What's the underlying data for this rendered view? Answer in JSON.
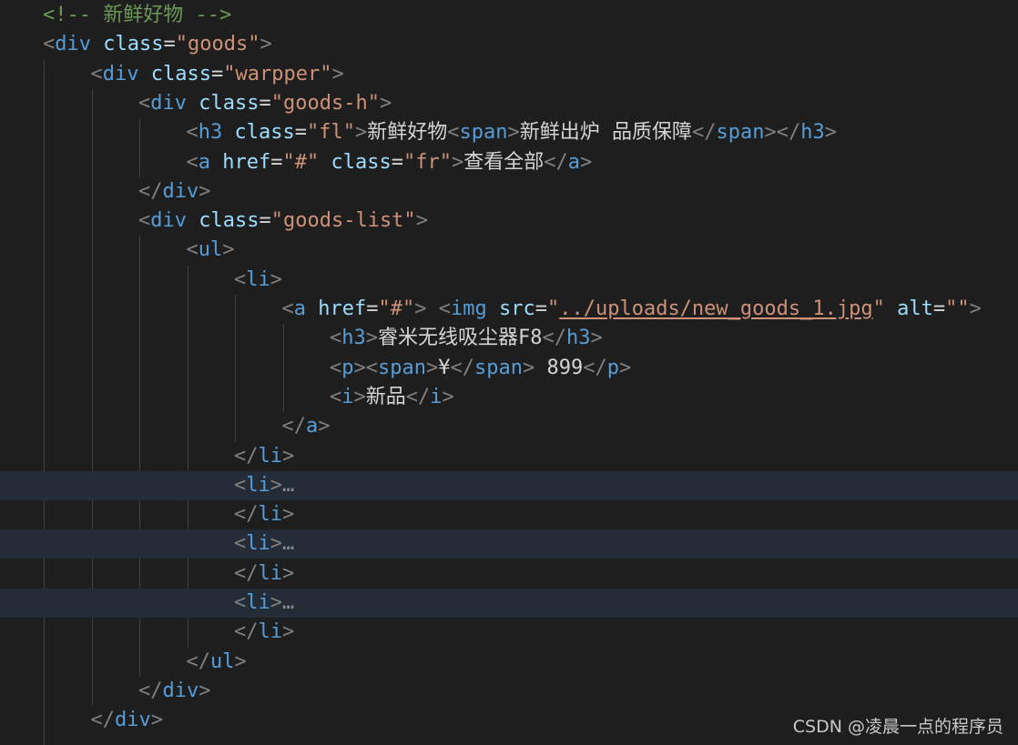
{
  "editor": {
    "language": "html",
    "colors": {
      "background": "#1e1e1e",
      "folded_line_background": "#232c37",
      "comment": "#6a9955",
      "tag": "#569cd6",
      "attribute": "#9cdcfe",
      "string": "#ce9178",
      "text": "#d4d4d4",
      "punctuation": "#808080"
    },
    "lines": [
      {
        "indent": 1,
        "tokens": [
          {
            "t": "comment",
            "v": "<!-- 新鲜好物 -->"
          }
        ]
      },
      {
        "indent": 1,
        "tokens": [
          {
            "t": "punc",
            "v": "<"
          },
          {
            "t": "tag",
            "v": "div"
          },
          {
            "t": "text",
            "v": " "
          },
          {
            "t": "attr",
            "v": "class"
          },
          {
            "t": "eq",
            "v": "="
          },
          {
            "t": "str",
            "v": "\"goods\""
          },
          {
            "t": "punc",
            "v": ">"
          }
        ]
      },
      {
        "indent": 2,
        "tokens": [
          {
            "t": "punc",
            "v": "<"
          },
          {
            "t": "tag",
            "v": "div"
          },
          {
            "t": "text",
            "v": " "
          },
          {
            "t": "attr",
            "v": "class"
          },
          {
            "t": "eq",
            "v": "="
          },
          {
            "t": "str",
            "v": "\"warpper\""
          },
          {
            "t": "punc",
            "v": ">"
          }
        ]
      },
      {
        "indent": 3,
        "tokens": [
          {
            "t": "punc",
            "v": "<"
          },
          {
            "t": "tag",
            "v": "div"
          },
          {
            "t": "text",
            "v": " "
          },
          {
            "t": "attr",
            "v": "class"
          },
          {
            "t": "eq",
            "v": "="
          },
          {
            "t": "str",
            "v": "\"goods-h\""
          },
          {
            "t": "punc",
            "v": ">"
          }
        ]
      },
      {
        "indent": 4,
        "tokens": [
          {
            "t": "punc",
            "v": "<"
          },
          {
            "t": "tag",
            "v": "h3"
          },
          {
            "t": "text",
            "v": " "
          },
          {
            "t": "attr",
            "v": "class"
          },
          {
            "t": "eq",
            "v": "="
          },
          {
            "t": "str",
            "v": "\"fl\""
          },
          {
            "t": "punc",
            "v": ">"
          },
          {
            "t": "text",
            "v": "新鲜好物"
          },
          {
            "t": "punc",
            "v": "<"
          },
          {
            "t": "tag",
            "v": "span"
          },
          {
            "t": "punc",
            "v": ">"
          },
          {
            "t": "text",
            "v": "新鲜出炉 品质保障"
          },
          {
            "t": "punc",
            "v": "</"
          },
          {
            "t": "tag",
            "v": "span"
          },
          {
            "t": "punc",
            "v": "></"
          },
          {
            "t": "tag",
            "v": "h3"
          },
          {
            "t": "punc",
            "v": ">"
          }
        ]
      },
      {
        "indent": 4,
        "tokens": [
          {
            "t": "punc",
            "v": "<"
          },
          {
            "t": "tag",
            "v": "a"
          },
          {
            "t": "text",
            "v": " "
          },
          {
            "t": "attr",
            "v": "href"
          },
          {
            "t": "eq",
            "v": "="
          },
          {
            "t": "str",
            "v": "\"#\""
          },
          {
            "t": "text",
            "v": " "
          },
          {
            "t": "attr",
            "v": "class"
          },
          {
            "t": "eq",
            "v": "="
          },
          {
            "t": "str",
            "v": "\"fr\""
          },
          {
            "t": "punc",
            "v": ">"
          },
          {
            "t": "text",
            "v": "查看全部"
          },
          {
            "t": "punc",
            "v": "</"
          },
          {
            "t": "tag",
            "v": "a"
          },
          {
            "t": "punc",
            "v": ">"
          }
        ]
      },
      {
        "indent": 3,
        "tokens": [
          {
            "t": "punc",
            "v": "</"
          },
          {
            "t": "tag",
            "v": "div"
          },
          {
            "t": "punc",
            "v": ">"
          }
        ]
      },
      {
        "indent": 3,
        "tokens": [
          {
            "t": "punc",
            "v": "<"
          },
          {
            "t": "tag",
            "v": "div"
          },
          {
            "t": "text",
            "v": " "
          },
          {
            "t": "attr",
            "v": "class"
          },
          {
            "t": "eq",
            "v": "="
          },
          {
            "t": "str",
            "v": "\"goods-list\""
          },
          {
            "t": "punc",
            "v": ">"
          }
        ]
      },
      {
        "indent": 4,
        "tokens": [
          {
            "t": "punc",
            "v": "<"
          },
          {
            "t": "tag",
            "v": "ul"
          },
          {
            "t": "punc",
            "v": ">"
          }
        ]
      },
      {
        "indent": 5,
        "tokens": [
          {
            "t": "punc",
            "v": "<"
          },
          {
            "t": "tag",
            "v": "li"
          },
          {
            "t": "punc",
            "v": ">"
          }
        ]
      },
      {
        "indent": 6,
        "tokens": [
          {
            "t": "punc",
            "v": "<"
          },
          {
            "t": "tag",
            "v": "a"
          },
          {
            "t": "text",
            "v": " "
          },
          {
            "t": "attr",
            "v": "href"
          },
          {
            "t": "eq",
            "v": "="
          },
          {
            "t": "str",
            "v": "\"#\""
          },
          {
            "t": "punc",
            "v": ">"
          },
          {
            "t": "text",
            "v": " "
          },
          {
            "t": "punc",
            "v": "<"
          },
          {
            "t": "tag",
            "v": "img"
          },
          {
            "t": "text",
            "v": " "
          },
          {
            "t": "attr",
            "v": "src"
          },
          {
            "t": "eq",
            "v": "="
          },
          {
            "t": "str",
            "v": "\""
          },
          {
            "t": "str link",
            "v": "../uploads/new_goods_1.jpg"
          },
          {
            "t": "str",
            "v": "\""
          },
          {
            "t": "text",
            "v": " "
          },
          {
            "t": "attr",
            "v": "alt"
          },
          {
            "t": "eq",
            "v": "="
          },
          {
            "t": "str",
            "v": "\"\""
          },
          {
            "t": "punc",
            "v": ">"
          }
        ]
      },
      {
        "indent": 7,
        "tokens": [
          {
            "t": "punc",
            "v": "<"
          },
          {
            "t": "tag",
            "v": "h3"
          },
          {
            "t": "punc",
            "v": ">"
          },
          {
            "t": "text",
            "v": "睿米无线吸尘器F8"
          },
          {
            "t": "punc",
            "v": "</"
          },
          {
            "t": "tag",
            "v": "h3"
          },
          {
            "t": "punc",
            "v": ">"
          }
        ]
      },
      {
        "indent": 7,
        "tokens": [
          {
            "t": "punc",
            "v": "<"
          },
          {
            "t": "tag",
            "v": "p"
          },
          {
            "t": "punc",
            "v": "><"
          },
          {
            "t": "tag",
            "v": "span"
          },
          {
            "t": "punc",
            "v": ">"
          },
          {
            "t": "text",
            "v": "¥"
          },
          {
            "t": "punc",
            "v": "</"
          },
          {
            "t": "tag",
            "v": "span"
          },
          {
            "t": "punc",
            "v": ">"
          },
          {
            "t": "text",
            "v": " 899"
          },
          {
            "t": "punc",
            "v": "</"
          },
          {
            "t": "tag",
            "v": "p"
          },
          {
            "t": "punc",
            "v": ">"
          }
        ]
      },
      {
        "indent": 7,
        "tokens": [
          {
            "t": "punc",
            "v": "<"
          },
          {
            "t": "tag",
            "v": "i"
          },
          {
            "t": "punc",
            "v": ">"
          },
          {
            "t": "text",
            "v": "新品"
          },
          {
            "t": "punc",
            "v": "</"
          },
          {
            "t": "tag",
            "v": "i"
          },
          {
            "t": "punc",
            "v": ">"
          }
        ]
      },
      {
        "indent": 6,
        "tokens": [
          {
            "t": "punc",
            "v": "</"
          },
          {
            "t": "tag",
            "v": "a"
          },
          {
            "t": "punc",
            "v": ">"
          }
        ]
      },
      {
        "indent": 5,
        "tokens": [
          {
            "t": "punc",
            "v": "</"
          },
          {
            "t": "tag",
            "v": "li"
          },
          {
            "t": "punc",
            "v": ">"
          }
        ]
      },
      {
        "indent": 5,
        "folded": true,
        "tokens": [
          {
            "t": "punc",
            "v": "<"
          },
          {
            "t": "tag",
            "v": "li"
          },
          {
            "t": "punc",
            "v": ">"
          },
          {
            "t": "fold",
            "v": "…"
          }
        ]
      },
      {
        "indent": 5,
        "tokens": [
          {
            "t": "punc",
            "v": "</"
          },
          {
            "t": "tag",
            "v": "li"
          },
          {
            "t": "punc",
            "v": ">"
          }
        ]
      },
      {
        "indent": 5,
        "folded": true,
        "tokens": [
          {
            "t": "punc",
            "v": "<"
          },
          {
            "t": "tag",
            "v": "li"
          },
          {
            "t": "punc",
            "v": ">"
          },
          {
            "t": "fold",
            "v": "…"
          }
        ]
      },
      {
        "indent": 5,
        "tokens": [
          {
            "t": "punc",
            "v": "</"
          },
          {
            "t": "tag",
            "v": "li"
          },
          {
            "t": "punc",
            "v": ">"
          }
        ]
      },
      {
        "indent": 5,
        "folded": true,
        "tokens": [
          {
            "t": "punc",
            "v": "<"
          },
          {
            "t": "tag",
            "v": "li"
          },
          {
            "t": "punc",
            "v": ">"
          },
          {
            "t": "fold",
            "v": "…"
          }
        ]
      },
      {
        "indent": 5,
        "tokens": [
          {
            "t": "punc",
            "v": "</"
          },
          {
            "t": "tag",
            "v": "li"
          },
          {
            "t": "punc",
            "v": ">"
          }
        ]
      },
      {
        "indent": 4,
        "tokens": [
          {
            "t": "punc",
            "v": "</"
          },
          {
            "t": "tag",
            "v": "ul"
          },
          {
            "t": "punc",
            "v": ">"
          }
        ]
      },
      {
        "indent": 3,
        "tokens": [
          {
            "t": "punc",
            "v": "</"
          },
          {
            "t": "tag",
            "v": "div"
          },
          {
            "t": "punc",
            "v": ">"
          }
        ]
      },
      {
        "indent": 2,
        "tokens": [
          {
            "t": "punc",
            "v": "</"
          },
          {
            "t": "tag",
            "v": "div"
          },
          {
            "t": "punc",
            "v": ">"
          }
        ]
      }
    ]
  },
  "watermark": "CSDN @凌晨一点的程序员"
}
